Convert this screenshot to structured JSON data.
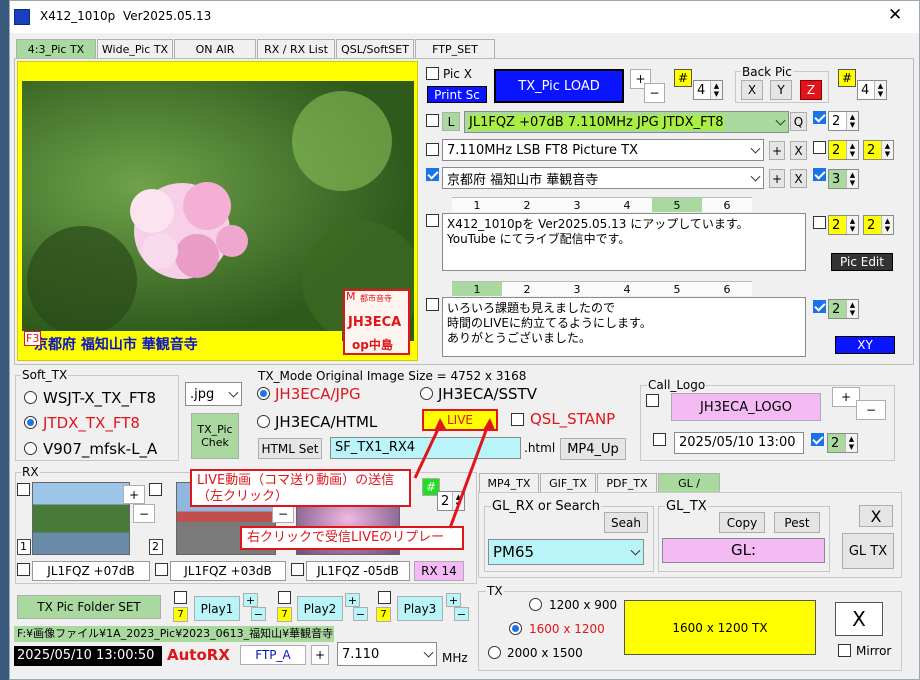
{
  "app": {
    "title": "X412_1010p",
    "version": "Ver2025.05.13"
  },
  "tabs": [
    "4:3_Pic TX",
    "Wide_Pic TX",
    "ON AIR",
    "RX / RX List",
    "QSL/SoftSET",
    "FTP_SET"
  ],
  "preview": {
    "caption": "京都府 福知山市 華観音寺",
    "f3": "F3",
    "stamp_m": "M",
    "stamp_top": "都市音寺",
    "stamp_call": "JH3ECA",
    "stamp_bottom": "op中島"
  },
  "pic": {
    "picx_label": "Pic X",
    "print_label": "Print Sc",
    "load_label": "TX_Pic  LOAD",
    "hash1": "#",
    "spin1": "4",
    "backpic_label": "Back Pic",
    "x": "X",
    "y": "Y",
    "z": "Z",
    "hash2": "#",
    "spin2": "4"
  },
  "lines": [
    {
      "l": "L",
      "text": "JL1FQZ +07dB  7.110MHz  JPG  JTDX_FT8",
      "q": "Q",
      "n": "2"
    },
    {
      "text": "7.110MHz  LSB  FT8 Picture TX",
      "n": "2",
      "n2": "2"
    },
    {
      "text": "京都府 福知山市 華観音寺",
      "n": "3"
    }
  ],
  "memo_tabs1": [
    "1",
    "2",
    "3",
    "4",
    "5",
    "6"
  ],
  "memo1": "X412_1010pを Ver2025.05.13 にアップしています。\nYouTube にてライブ配信中です。",
  "memo1_n": "2",
  "memo1_n2": "2",
  "pic_edit": "Pic  Edit",
  "memo_tabs2": [
    "1",
    "2",
    "3",
    "4",
    "5",
    "6"
  ],
  "memo2": "いろいろ課題も見えましたので\n時間のLIVEに約立てるようにします。\nありがとうございました。",
  "memo2_n": "2",
  "xy": "XY",
  "plus": "+",
  "minus": "−",
  "xbtn": "X",
  "soft_tx": {
    "title": "Soft_TX",
    "items": [
      "WSJT-X_TX_FT8",
      "JTDX_TX_FT8",
      "V907_mfsk-L_A"
    ]
  },
  "format": ".jpg",
  "txchk": "TX_Pic Chek",
  "txmode": {
    "title": "TX_Mode  Original  Image  Size = 4752 x 3168",
    "o1": "JH3ECA/JPG",
    "o2": "JH3ECA/SSTV",
    "o3": "JH3ECA/HTML",
    "live": "LIVE",
    "stamp": "QSL_STANP",
    "html_set": "HTML Set",
    "file": "SF_TX1_RX4",
    "ext": ".html",
    "mp4": "MP4_Up"
  },
  "logo": {
    "title": "Call_Logo",
    "name": "JH3ECA_LOGO",
    "date": "2025/05/10  13:00",
    "n": "2"
  },
  "rx": {
    "title": "RX",
    "hash": "#",
    "spin": "2",
    "nums": [
      "1",
      "2"
    ],
    "calls": [
      "JL1FQZ +07dB",
      "JL1FQZ +03dB",
      "JL1FQZ -05dB"
    ],
    "rx14": "RX 14"
  },
  "callouts": {
    "a": "LIVE動画（コマ送り動画）の送信\n（左クリック）",
    "b": "右クリックで受信LIVEのリプレー"
  },
  "gl": {
    "tabs": [
      "MP4_TX",
      "GIF_TX",
      "PDF_TX",
      "GL /"
    ],
    "search": "GL_RX or Search",
    "seah": "Seah",
    "val": "PM65",
    "gltx": "GL_TX",
    "copy": "Copy",
    "pest": "Pest",
    "gl": "GL:",
    "x": "X",
    "tx": "GL TX"
  },
  "tx": {
    "title": "TX",
    "sizes": [
      "1200 x 900",
      "1600 x 1200",
      "2000 x 1500"
    ],
    "btn": "1600 x 1200   TX",
    "x": "X",
    "mirror": "Mirror"
  },
  "bottom": {
    "folder": "TX Pic  Folder SET",
    "sev": "7",
    "play": [
      "Play1",
      "Play2",
      "Play3"
    ],
    "path": "F:¥画像ファイル¥1A_2023_Pic¥2023_0613_福知山¥華観音寺",
    "clock": "2025/05/10   13:00:50",
    "autorx": "AutoRX",
    "ftp": "FTP_A",
    "freq": "7.110",
    "mhz": "MHz"
  },
  "colors": {
    "green": "#aad9a0",
    "blue": "#0a14ff",
    "yellow": "#ffff00",
    "pink": "#f4baf4",
    "cyan": "#b8f4f8",
    "red": "#e0151b"
  }
}
